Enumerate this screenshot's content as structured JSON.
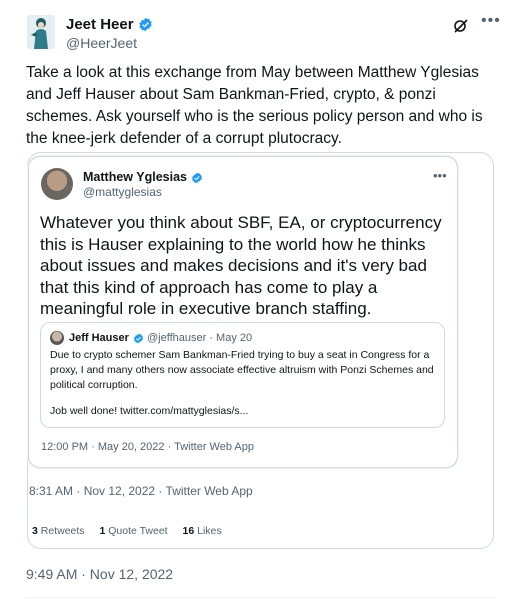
{
  "tweet": {
    "author_name": "Jeet Heer",
    "author_handle": "@HeerJeet",
    "text": "Take a look at this exchange from May between Matthew Yglesias and Jeff Hauser about Sam Bankman-Fried, crypto, & ponzi schemes. Ask yourself who is the serious policy person and who is the knee-jerk defender of a corrupt plutocracy.",
    "timestamp": "9:49 AM · Nov 12, 2022"
  },
  "quoted": {
    "author_name": "Matthew Yglesias",
    "author_handle": "@mattyglesias",
    "text": "Whatever you think about SBF, EA, or cryptocurrency this is Hauser explaining to the world how he thinks about issues and makes decisions and it's very bad that this kind of approach has come to play a meaningful role in executive branch staffing.",
    "timestamp": "12:00 PM · May 20, 2022 · Twitter Web App",
    "outer_timestamp": "8:31 AM · Nov 12, 2022 · Twitter Web App",
    "retweets_count": "3",
    "retweets_label": "Retweets",
    "quote_count": "1",
    "quote_label": "Quote Tweet",
    "likes_count": "16",
    "likes_label": "Likes"
  },
  "nested": {
    "author_name": "Jeff Hauser",
    "handle_and_date": "@jeffhauser · May 20",
    "text": "Due to crypto schemer Sam Bankman-Fried trying to buy a seat in Congress for a proxy, I and many others now associate effective altruism with Ponzi Schemes and political corruption.",
    "link_text": "Job well done! twitter.com/mattyglesias/s..."
  },
  "icons": {
    "verified": "verified-badge-icon",
    "grok": "grok-icon",
    "more": "more-icon"
  },
  "colors": {
    "accent": "#1d9bf0",
    "secondary_text": "#536471",
    "border": "#cfd9de"
  }
}
